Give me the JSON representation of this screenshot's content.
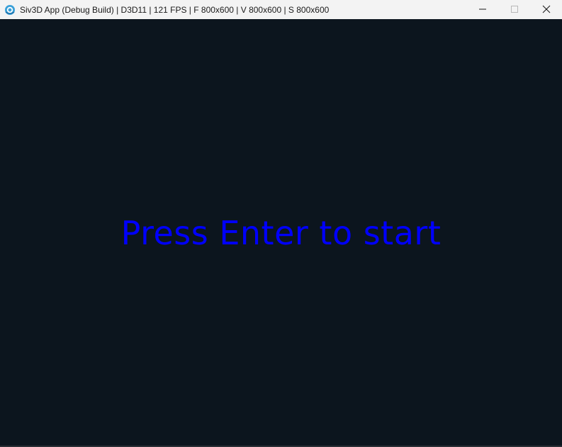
{
  "window": {
    "title": "Siv3D App (Debug Build) | D3D11 | 121 FPS | F 800x600 | V 800x600 | S 800x600",
    "app_icon": "siv3d-logo-icon",
    "controls": {
      "minimize_icon": "minimize-icon",
      "maximize_icon": "maximize-icon",
      "close_icon": "close-icon"
    }
  },
  "game": {
    "prompt_text": "Press Enter to start",
    "prompt_color": "#0000ff",
    "background_color": "#0c151e"
  }
}
